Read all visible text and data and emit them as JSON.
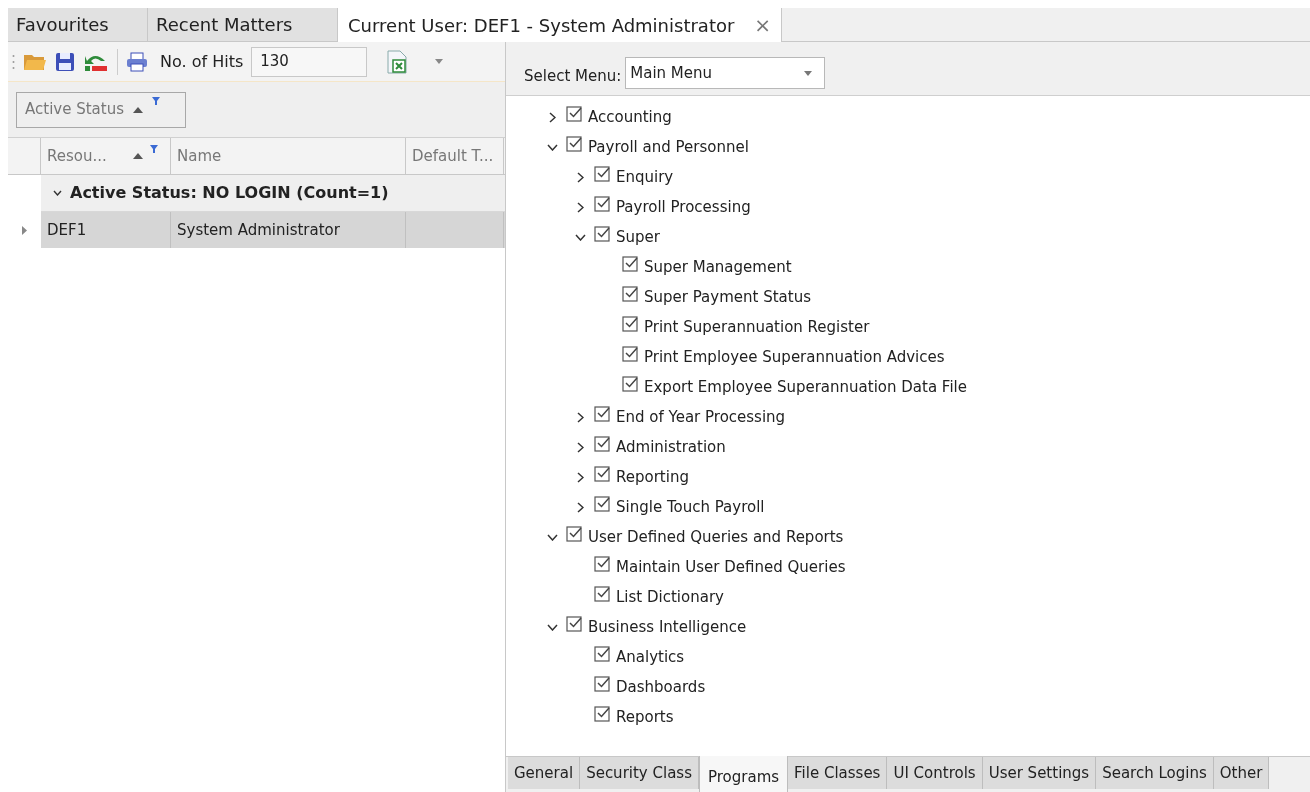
{
  "tabs": [
    {
      "label": "Favourites",
      "selected": false
    },
    {
      "label": "Recent Matters",
      "selected": false
    },
    {
      "label": "Current User: DEF1 - System Administrator",
      "selected": true,
      "close_glyph": "×"
    }
  ],
  "toolbar": {
    "hits_label": "No. of Hits",
    "hits_value": "130"
  },
  "group_panel": {
    "label": "Active Status",
    "sorted": true,
    "filter": true
  },
  "grid": {
    "columns": [
      {
        "label": "Resou...",
        "sorted": true,
        "filter": true
      },
      {
        "label": "Name",
        "sorted": false,
        "filter": false
      },
      {
        "label": "Default T...",
        "sorted": false,
        "filter": false
      }
    ],
    "group_row": {
      "label": "Active Status: NO LOGIN (Count=1)",
      "expanded": true
    },
    "rows": [
      {
        "cells": [
          "DEF1",
          "System Administrator"
        ],
        "selected": true
      }
    ]
  },
  "select_menu": {
    "label": "Select Menu:",
    "value": "Main Menu"
  },
  "tree": [
    {
      "label": "Accounting",
      "checked": true,
      "kind": "folder",
      "expanded": false
    },
    {
      "label": "Payroll and Personnel",
      "checked": true,
      "kind": "folder",
      "expanded": true,
      "children": [
        {
          "label": "Enquiry",
          "checked": true,
          "kind": "folder",
          "expanded": false
        },
        {
          "label": "Payroll Processing",
          "checked": true,
          "kind": "folder",
          "expanded": false
        },
        {
          "label": "Super",
          "checked": true,
          "kind": "folder",
          "expanded": true,
          "children": [
            {
              "label": "Super Management",
              "checked": true,
              "kind": "leaf"
            },
            {
              "label": "Super Payment Status",
              "checked": true,
              "kind": "leaf"
            },
            {
              "label": "Print Superannuation Register",
              "checked": true,
              "kind": "leaf"
            },
            {
              "label": "Print Employee Superannuation Advices",
              "checked": true,
              "kind": "leaf"
            },
            {
              "label": "Export Employee Superannuation Data File",
              "checked": true,
              "kind": "leaf"
            }
          ]
        },
        {
          "label": "End of Year Processing",
          "checked": true,
          "kind": "folder",
          "expanded": false
        },
        {
          "label": "Administration",
          "checked": true,
          "kind": "folder",
          "expanded": false
        },
        {
          "label": "Reporting",
          "checked": true,
          "kind": "folder",
          "expanded": false
        },
        {
          "label": "Single Touch Payroll",
          "checked": true,
          "kind": "folder",
          "expanded": false
        }
      ]
    },
    {
      "label": "User Defined Queries and Reports",
      "checked": true,
      "kind": "folder",
      "expanded": true,
      "children": [
        {
          "label": "Maintain User Defined Queries",
          "checked": true,
          "kind": "leaf"
        },
        {
          "label": "List Dictionary",
          "checked": true,
          "kind": "leaf"
        }
      ]
    },
    {
      "label": "Business Intelligence",
      "checked": true,
      "kind": "folder",
      "expanded": true,
      "children": [
        {
          "label": "Analytics",
          "checked": true,
          "kind": "leaf"
        },
        {
          "label": "Dashboards",
          "checked": true,
          "kind": "leaf"
        },
        {
          "label": "Reports",
          "checked": true,
          "kind": "leaf"
        }
      ]
    }
  ],
  "bottom_tabs": [
    {
      "label": "General",
      "selected": false
    },
    {
      "label": "Security Class",
      "selected": false
    },
    {
      "label": "Programs",
      "selected": true
    },
    {
      "label": "File Classes",
      "selected": false
    },
    {
      "label": "UI Controls",
      "selected": false
    },
    {
      "label": "User Settings",
      "selected": false
    },
    {
      "label": "Search Logins",
      "selected": false
    },
    {
      "label": "Other",
      "selected": false
    }
  ]
}
